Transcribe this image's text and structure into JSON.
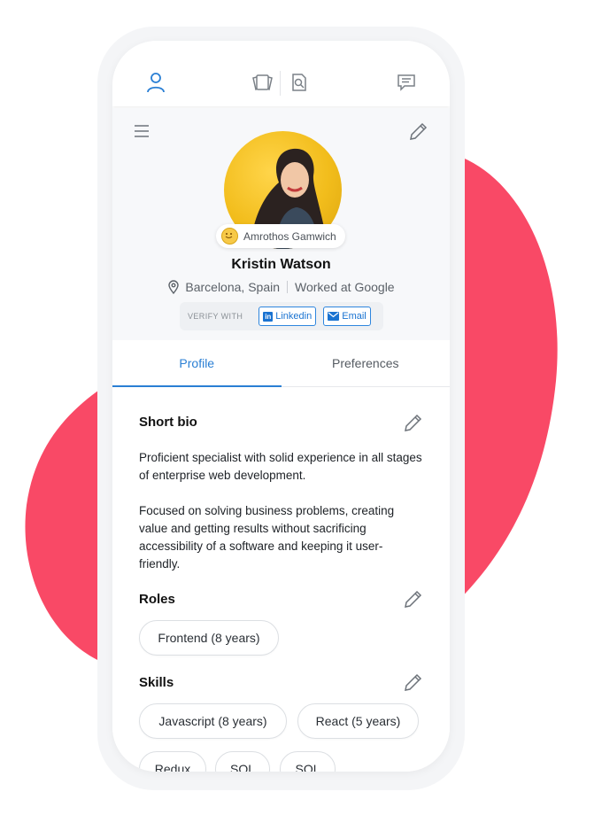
{
  "user": {
    "username": "Amrothos Gamwich",
    "name": "Kristin Watson",
    "location": "Barcelona, Spain",
    "work": "Worked at Google"
  },
  "verify": {
    "label": "VERIFY WITH",
    "linkedin": "Linkedin",
    "email": "Email"
  },
  "tabs": [
    {
      "label": "Profile",
      "active": true
    },
    {
      "label": "Preferences",
      "active": false
    }
  ],
  "bio": {
    "title": "Short bio",
    "paragraph1": "Proficient specialist with solid experience in all stages of enterprise web development.",
    "paragraph2": "Focused on solving business problems, creating value and getting results without sacrificing accessibility of a software and keeping it user-friendly."
  },
  "roles": {
    "title": "Roles",
    "items": [
      "Frontend (8 years)"
    ]
  },
  "skills": {
    "title": "Skills",
    "items": [
      "Javascript (8 years)",
      "React (5 years)",
      "Redux",
      "SQL",
      "SQL"
    ]
  },
  "colors": {
    "accent": "#2a7fd4",
    "blob": "#f94966"
  },
  "icons": {
    "nav": [
      "user-icon",
      "cards-icon",
      "search-document-icon",
      "chat-icon"
    ],
    "menu": "hamburger-icon",
    "edit": "pencil-icon",
    "location": "location-pin-icon"
  }
}
